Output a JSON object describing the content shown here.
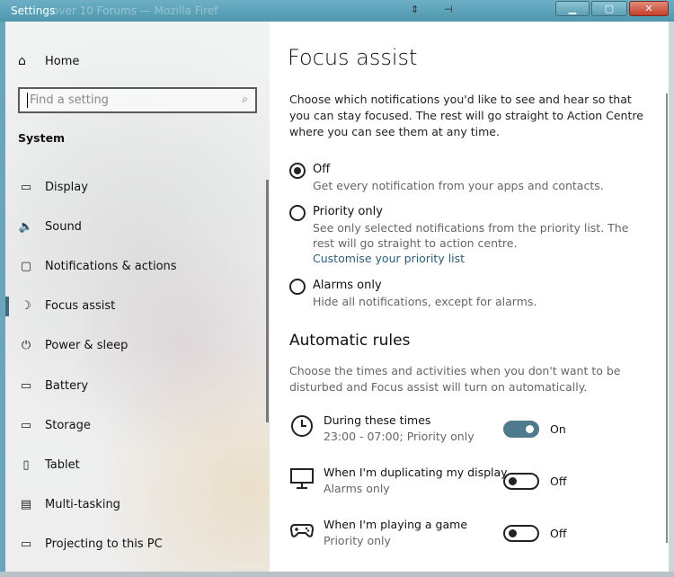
{
  "titlebar": {
    "title": "Settings",
    "ghost_text": "over 10 Forums — Mozilla Firef",
    "controls": {
      "minimize": "▁",
      "maximize": "▢",
      "close": "✕"
    }
  },
  "sidebar": {
    "home_label": "Home",
    "search_placeholder": "Find a setting",
    "section_label": "System",
    "items": [
      {
        "label": "Display",
        "icon": "display-icon",
        "glyph": "▭"
      },
      {
        "label": "Sound",
        "icon": "speaker-icon",
        "glyph": "🔈"
      },
      {
        "label": "Notifications & actions",
        "icon": "notification-icon",
        "glyph": "▢"
      },
      {
        "label": "Focus assist",
        "icon": "moon-icon",
        "glyph": "☽"
      },
      {
        "label": "Power & sleep",
        "icon": "power-icon",
        "glyph": "⏻"
      },
      {
        "label": "Battery",
        "icon": "battery-icon",
        "glyph": "▭"
      },
      {
        "label": "Storage",
        "icon": "storage-icon",
        "glyph": "▭"
      },
      {
        "label": "Tablet",
        "icon": "tablet-icon",
        "glyph": "▯"
      },
      {
        "label": "Multi-tasking",
        "icon": "multitasking-icon",
        "glyph": "▤"
      },
      {
        "label": "Projecting to this PC",
        "icon": "projecting-icon",
        "glyph": "▭"
      }
    ],
    "active_index": 3
  },
  "content": {
    "title": "Focus assist",
    "intro": "Choose which notifications you'd like to see and hear so that you can stay focused. The rest will go straight to Action Centre where you can see them at any time.",
    "options": [
      {
        "label": "Off",
        "desc": "Get every notification from your apps and contacts.",
        "checked": true
      },
      {
        "label": "Priority only",
        "desc": "See only selected notifications from the priority list. The rest will go straight to action centre.",
        "link": "Customise your priority list",
        "checked": false
      },
      {
        "label": "Alarms only",
        "desc": "Hide all notifications, except for alarms.",
        "checked": false
      }
    ],
    "rules_heading": "Automatic rules",
    "rules_desc": "Choose the times and activities when you don't want to be disturbed and Focus assist will turn on automatically.",
    "rules": [
      {
        "name": "During these times",
        "sub": "23:00 - 07:00; Priority only",
        "state": "On",
        "on": true,
        "icon": "clock-icon"
      },
      {
        "name": "When I'm duplicating my display",
        "sub": "Alarms only",
        "state": "Off",
        "on": false,
        "icon": "monitor-icon"
      },
      {
        "name": "When I'm playing a game",
        "sub": "Priority only",
        "state": "Off",
        "on": false,
        "icon": "gamepad-icon"
      }
    ]
  }
}
